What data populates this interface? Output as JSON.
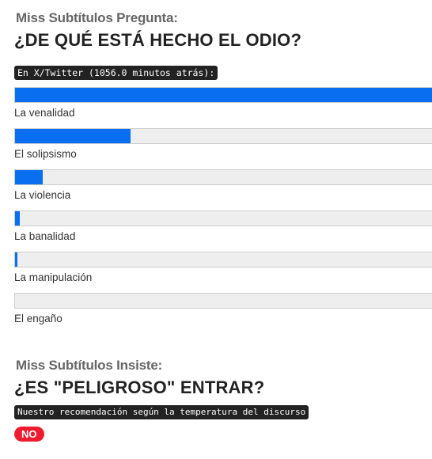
{
  "question1": {
    "kicker": "Miss Subtítulos Pregunta:",
    "headline": "¿DE QUÉ ESTÁ HECHO EL ODIO?",
    "source": "En X/Twitter (1056.0 minutos atrás):"
  },
  "poll": {
    "accent_color": "#0a6ef0",
    "track_color": "#eeeeee",
    "options": [
      {
        "label": "La venalidad",
        "share": 1.0
      },
      {
        "label": "El solipsismo",
        "share": 0.277
      },
      {
        "label": "La violencia",
        "share": 0.066
      },
      {
        "label": "La banalidad",
        "share": 0.012
      },
      {
        "label": "La manipulación",
        "share": 0.006
      },
      {
        "label": "El engaño",
        "share": 0.0
      }
    ]
  },
  "question2": {
    "kicker": "Miss Subtítulos Insiste:",
    "headline": "¿ES \"PELIGROSO\" ENTRAR?",
    "note": "Nuestro recomendación según la temperatura del discurso",
    "answer": "NO",
    "answer_color": "#ee1c2e"
  }
}
